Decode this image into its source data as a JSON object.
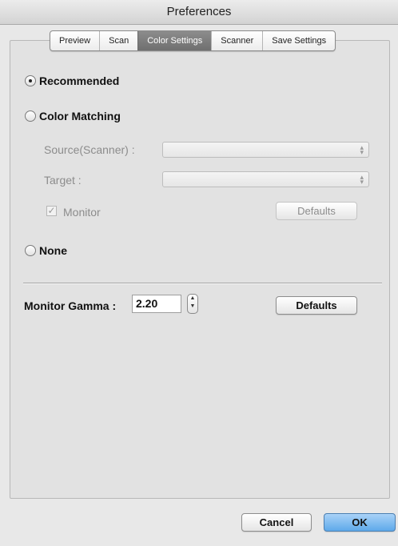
{
  "window": {
    "title": "Preferences"
  },
  "tabs": [
    {
      "label": "Preview"
    },
    {
      "label": "Scan"
    },
    {
      "label": "Color Settings"
    },
    {
      "label": "Scanner"
    },
    {
      "label": "Save Settings"
    }
  ],
  "color": {
    "recommended_label": "Recommended",
    "recommended_selected": true,
    "matching_label": "Color Matching",
    "source_label": "Source(Scanner) :",
    "source_value": "",
    "target_label": "Target :",
    "target_value": "",
    "monitor_label": "Monitor",
    "monitor_checked": true,
    "defaults_label": "Defaults",
    "none_label": "None"
  },
  "gamma": {
    "label": "Monitor Gamma :",
    "value": "2.20",
    "defaults_label": "Defaults"
  },
  "footer": {
    "cancel_label": "Cancel",
    "ok_label": "OK"
  },
  "colors": {
    "active_tab": "#7d7d7d",
    "ok_button": "#6fb2ee",
    "disabled_text": "#8c8c8c"
  }
}
